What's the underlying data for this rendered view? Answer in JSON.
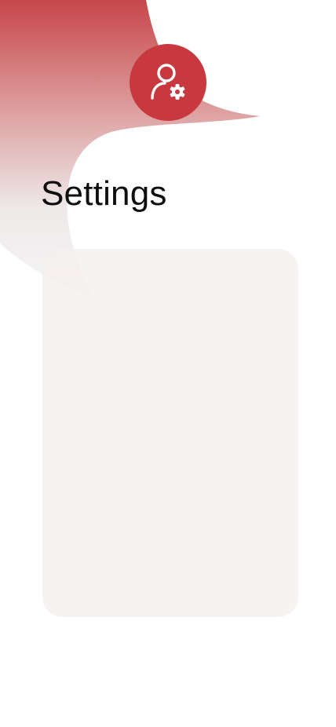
{
  "header": {
    "title": "Settings",
    "icon": "user-settings-icon"
  },
  "colors": {
    "accent": "#c7383f",
    "blob_top": "#c9474b",
    "blob_fade": "#f0ecec",
    "card_background": "#f7f3f2",
    "title_text": "#0f0f0f",
    "page_background": "#ffffff"
  },
  "settings_card": {
    "items": []
  }
}
